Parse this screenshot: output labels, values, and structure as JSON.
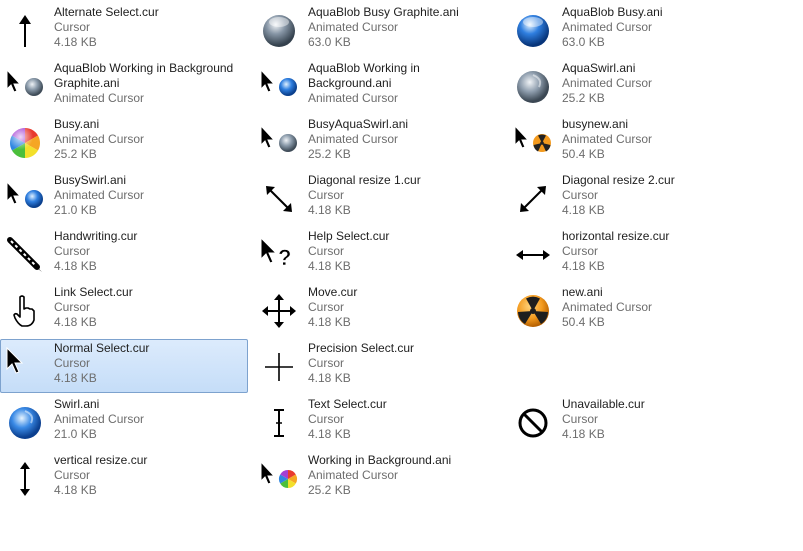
{
  "files": {
    "col0": [
      {
        "name": "Alternate Select.cur",
        "type": "Cursor",
        "size": "4.18 KB",
        "icon": "alternate-select-icon"
      },
      {
        "name": "AquaBlob Working in Background Graphite.ani",
        "type": "Animated Cursor",
        "size": "",
        "icon": "aquablob-working-graphite-icon"
      },
      {
        "name": "Busy.ani",
        "type": "Animated Cursor",
        "size": "25.2 KB",
        "icon": "busy-icon"
      },
      {
        "name": "BusySwirl.ani",
        "type": "Animated Cursor",
        "size": "21.0 KB",
        "icon": "busy-swirl-icon"
      },
      {
        "name": "Handwriting.cur",
        "type": "Cursor",
        "size": "4.18 KB",
        "icon": "handwriting-icon"
      },
      {
        "name": "Link Select.cur",
        "type": "Cursor",
        "size": "4.18 KB",
        "icon": "link-select-icon"
      },
      {
        "name": "Normal Select.cur",
        "type": "Cursor",
        "size": "4.18 KB",
        "icon": "normal-select-icon",
        "selected": true
      },
      {
        "name": "Swirl.ani",
        "type": "Animated Cursor",
        "size": "21.0 KB",
        "icon": "swirl-icon"
      },
      {
        "name": "vertical resize.cur",
        "type": "Cursor",
        "size": "4.18 KB",
        "icon": "vertical-resize-icon"
      }
    ],
    "col1": [
      {
        "name": "AquaBlob Busy Graphite.ani",
        "type": "Animated Cursor",
        "size": "63.0 KB",
        "icon": "aquablob-busy-graphite-icon"
      },
      {
        "name": "AquaBlob Working in Background.ani",
        "type": "Animated Cursor",
        "size": "",
        "icon": "aquablob-working-icon"
      },
      {
        "name": "BusyAquaSwirl.ani",
        "type": "Animated Cursor",
        "size": "25.2 KB",
        "icon": "busy-aqua-swirl-icon"
      },
      {
        "name": "Diagonal resize 1.cur",
        "type": "Cursor",
        "size": "4.18 KB",
        "icon": "diagonal-resize-1-icon"
      },
      {
        "name": "Help Select.cur",
        "type": "Cursor",
        "size": "4.18 KB",
        "icon": "help-select-icon"
      },
      {
        "name": "Move.cur",
        "type": "Cursor",
        "size": "4.18 KB",
        "icon": "move-icon"
      },
      {
        "name": "Precision Select.cur",
        "type": "Cursor",
        "size": "4.18 KB",
        "icon": "precision-select-icon"
      },
      {
        "name": "Text Select.cur",
        "type": "Cursor",
        "size": "4.18 KB",
        "icon": "text-select-icon"
      },
      {
        "name": "Working in Background.ani",
        "type": "Animated Cursor",
        "size": "25.2 KB",
        "icon": "working-background-icon"
      }
    ],
    "col2": [
      {
        "name": "AquaBlob Busy.ani",
        "type": "Animated Cursor",
        "size": "63.0 KB",
        "icon": "aquablob-busy-icon"
      },
      {
        "name": "AquaSwirl.ani",
        "type": "Animated Cursor",
        "size": "25.2 KB",
        "icon": "aqua-swirl-icon"
      },
      {
        "name": "busynew.ani",
        "type": "Animated Cursor",
        "size": "50.4 KB",
        "icon": "busynew-icon"
      },
      {
        "name": "Diagonal resize 2.cur",
        "type": "Cursor",
        "size": "4.18 KB",
        "icon": "diagonal-resize-2-icon"
      },
      {
        "name": "horizontal resize.cur",
        "type": "Cursor",
        "size": "4.18 KB",
        "icon": "horizontal-resize-icon"
      },
      {
        "name": "new.ani",
        "type": "Animated Cursor",
        "size": "50.4 KB",
        "icon": "new-ani-icon"
      },
      {
        "name": "",
        "type": "",
        "size": "",
        "icon": ""
      },
      {
        "name": "Unavailable.cur",
        "type": "Cursor",
        "size": "4.18 KB",
        "icon": "unavailable-icon"
      }
    ]
  },
  "colors": {
    "selection_fill": "#cce2fb",
    "selection_border": "#7da2ce",
    "aqua_blue": "#2f7fe0",
    "graphite": "#6f7f8f",
    "radioactive_orange": "#f39a1e"
  }
}
